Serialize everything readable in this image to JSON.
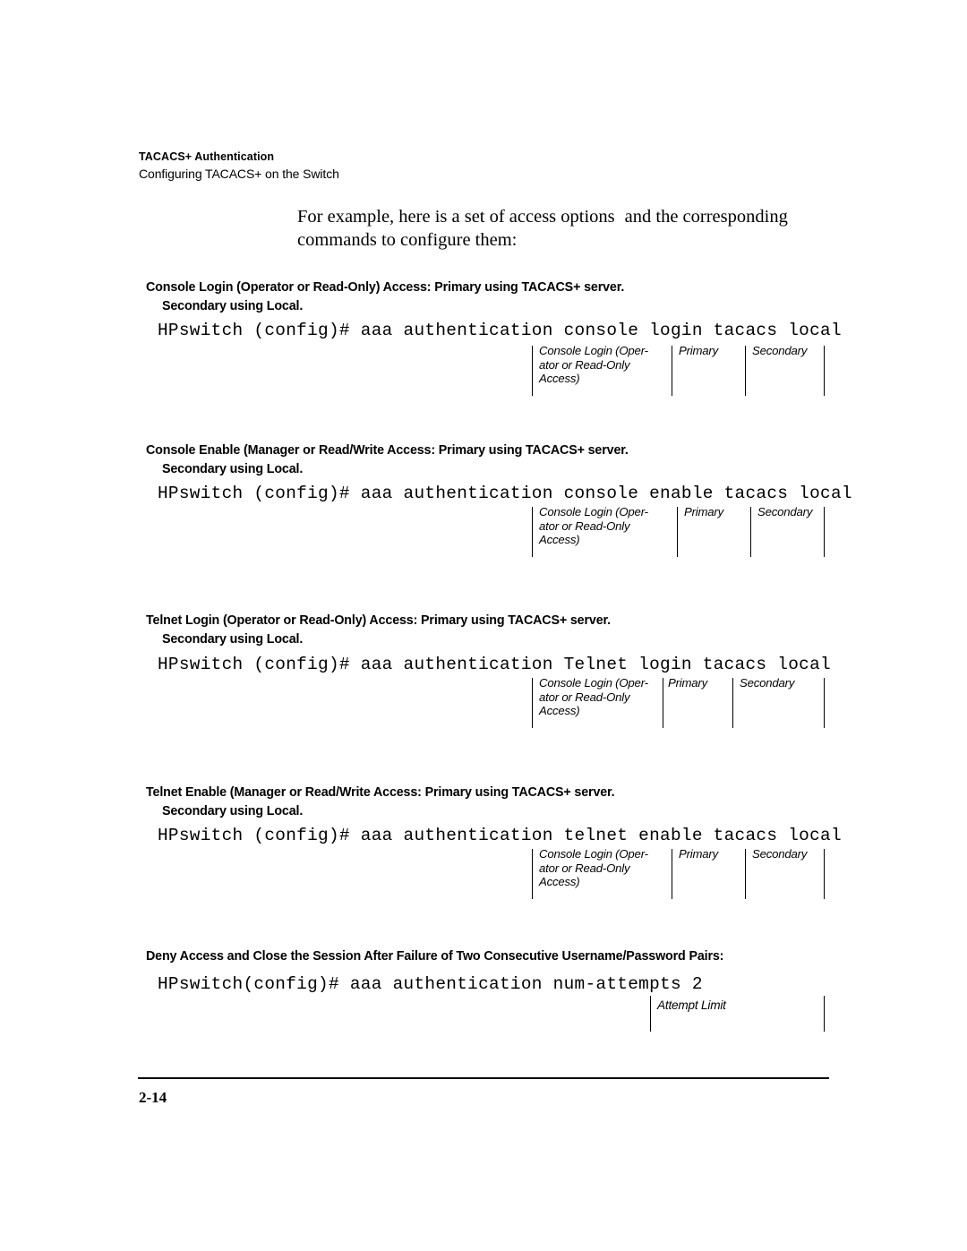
{
  "header": {
    "title": "TACACS+ Authentication",
    "subtitle": "Configuring TACACS+ on the Switch"
  },
  "intro": {
    "line1_a": "For example, here is a set of access options",
    "line1_b": "and the corresponding",
    "line2": "commands to configure them:"
  },
  "sections": [
    {
      "heading_line1": "Console Login (Operator or Read-Only) Access: Primary using TACACS+ server.",
      "heading_line2": "Secondary using Local.",
      "command": "HPswitch (config)# aaa authentication console login tacacs local",
      "callout": {
        "label1": "Console Login (Oper-\nator or Read-Only\nAccess)",
        "label2": "Primary",
        "label3": "Secondary"
      }
    },
    {
      "heading_line1": "Console Enable (Manager or Read/Write Access: Primary using TACACS+ server.",
      "heading_line2": "Secondary using Local.",
      "command": "HPswitch (config)# aaa authentication console enable tacacs local",
      "callout": {
        "label1": "Console Login (Oper-\nator or Read-Only\nAccess)",
        "label2": "Primary",
        "label3": "Secondary"
      }
    },
    {
      "heading_line1": "Telnet Login (Operator or Read-Only) Access: Primary using TACACS+ server.",
      "heading_line2": "Secondary using Local.",
      "command": "HPswitch (config)# aaa authentication Telnet login tacacs local",
      "callout": {
        "label1": "Console Login (Oper-\nator or Read-Only\nAccess)",
        "label2": "Primary",
        "label3": "Secondary"
      }
    },
    {
      "heading_line1": "Telnet Enable (Manager or Read/Write Access: Primary using TACACS+ server.",
      "heading_line2": "Secondary using Local.",
      "command": "HPswitch (config)# aaa authentication telnet enable tacacs local",
      "callout": {
        "label1": "Console Login (Oper-\nator or Read-Only\nAccess)",
        "label2": "Primary",
        "label3": "Secondary"
      }
    }
  ],
  "deny_section": {
    "heading": "Deny Access and Close the Session After Failure of Two Consecutive Username/Password Pairs:",
    "command": "HPswitch(config)# aaa authentication num-attempts 2",
    "callout": {
      "label1": "Attempt Limit"
    }
  },
  "footer": {
    "page_number": "2-14"
  },
  "colors": {
    "text": "#000000",
    "background": "#ffffff",
    "rule": "#000000"
  }
}
